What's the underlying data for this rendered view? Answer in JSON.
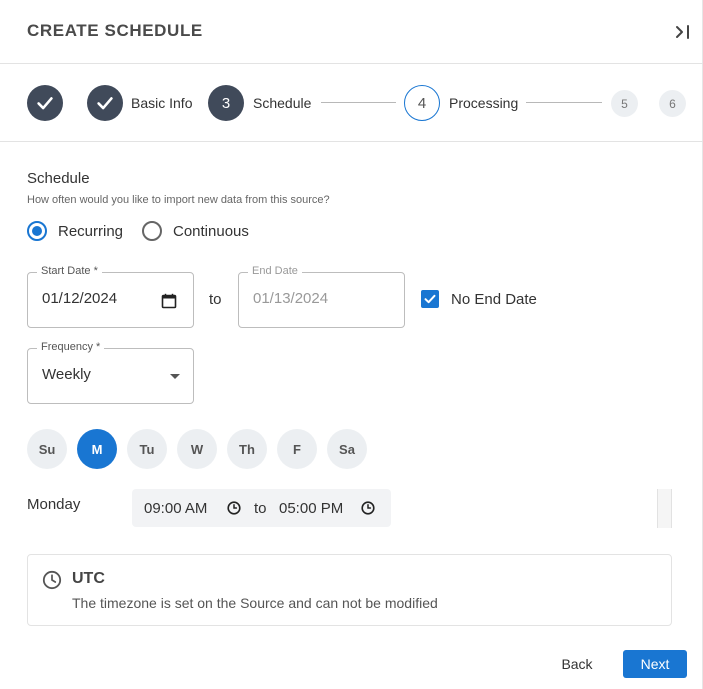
{
  "header": {
    "title": "CREATE SCHEDULE",
    "collapse_icon": "collapse-right-icon"
  },
  "stepper": {
    "steps": [
      {
        "number": "1",
        "label": "",
        "state": "done"
      },
      {
        "number": "2",
        "label": "Basic Info",
        "state": "done"
      },
      {
        "number": "3",
        "label": "Schedule",
        "state": "active"
      },
      {
        "number": "4",
        "label": "Processing",
        "state": "upcoming"
      },
      {
        "number": "5",
        "label": "",
        "state": "upcoming"
      },
      {
        "number": "6",
        "label": "",
        "state": "upcoming"
      }
    ]
  },
  "schedule": {
    "title": "Schedule",
    "subtitle": "How often would you like to import new data from this source?",
    "modes": [
      {
        "label": "Recurring",
        "selected": true
      },
      {
        "label": "Continuous",
        "selected": false
      }
    ],
    "start_date": {
      "label": "Start Date *",
      "value": "01/12/2024"
    },
    "to_label": "to",
    "end_date": {
      "label": "End Date",
      "value": "01/13/2024",
      "disabled": true
    },
    "no_end_date": {
      "label": "No End Date",
      "checked": true
    },
    "frequency": {
      "label": "Frequency *",
      "value": "Weekly"
    },
    "days": [
      {
        "label": "Su",
        "selected": false
      },
      {
        "label": "M",
        "selected": true
      },
      {
        "label": "Tu",
        "selected": false
      },
      {
        "label": "W",
        "selected": false
      },
      {
        "label": "Th",
        "selected": false
      },
      {
        "label": "F",
        "selected": false
      },
      {
        "label": "Sa",
        "selected": false
      }
    ],
    "time_rows": [
      {
        "day": "Monday",
        "start": "09:00 AM",
        "to": "to",
        "end": "05:00 PM"
      }
    ],
    "timezone": {
      "name": "UTC",
      "message": "The timezone is set on the Source and can not be modified"
    }
  },
  "footer": {
    "back_label": "Back",
    "next_label": "Next"
  },
  "colors": {
    "accent": "#1976d2",
    "step_done": "#404a5a"
  }
}
